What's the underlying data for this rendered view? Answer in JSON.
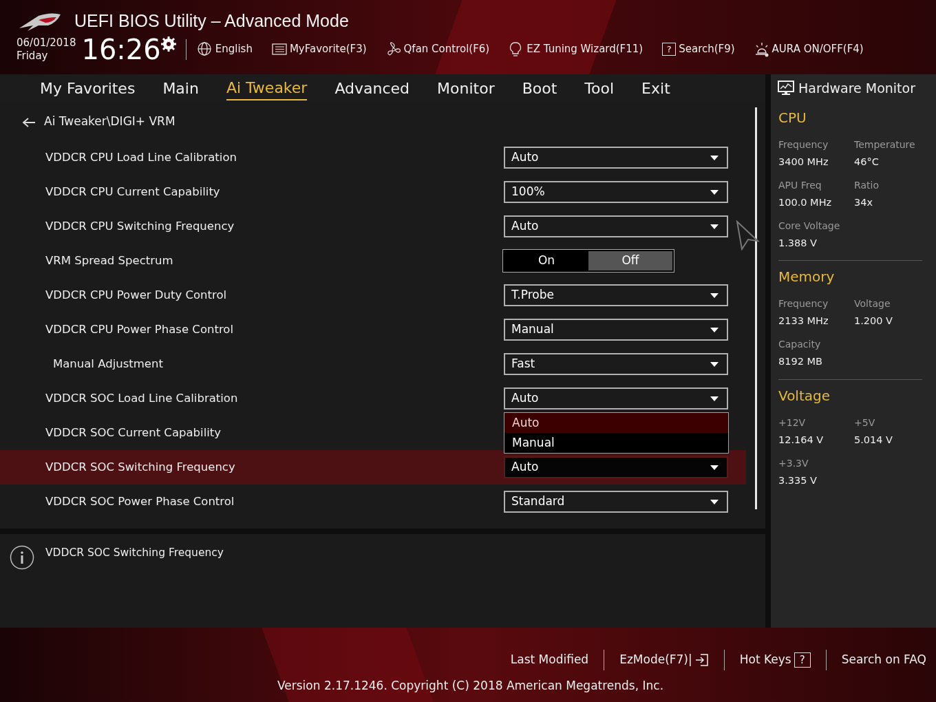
{
  "header": {
    "title": "UEFI BIOS Utility – Advanced Mode",
    "date": "06/01/2018",
    "day": "Friday",
    "time": "16:26",
    "tools": [
      {
        "label": "English"
      },
      {
        "label": "MyFavorite(F3)"
      },
      {
        "label": "Qfan Control(F6)"
      },
      {
        "label": "EZ Tuning Wizard(F11)"
      },
      {
        "label": "Search(F9)",
        "glyph": "?"
      },
      {
        "label": "AURA ON/OFF(F4)"
      }
    ]
  },
  "tabs": [
    {
      "label": "My Favorites",
      "selected": false
    },
    {
      "label": "Main",
      "selected": false
    },
    {
      "label": "Ai Tweaker",
      "selected": true
    },
    {
      "label": "Advanced",
      "selected": false
    },
    {
      "label": "Monitor",
      "selected": false
    },
    {
      "label": "Boot",
      "selected": false
    },
    {
      "label": "Tool",
      "selected": false
    },
    {
      "label": "Exit",
      "selected": false
    }
  ],
  "breadcrumb": "Ai Tweaker\\DIGI+ VRM",
  "settings": [
    {
      "label": "VDDCR CPU Load Line Calibration",
      "kind": "select",
      "value": "Auto",
      "selected": false
    },
    {
      "label": "VDDCR CPU Current Capability",
      "kind": "select",
      "value": "100%",
      "selected": false
    },
    {
      "label": "VDDCR CPU Switching Frequency",
      "kind": "select",
      "value": "Auto",
      "selected": false
    },
    {
      "label": "VRM Spread Spectrum",
      "kind": "toggle",
      "options": [
        {
          "label": "On",
          "selected": false
        },
        {
          "label": "Off",
          "selected": true
        }
      ],
      "selected": false
    },
    {
      "label": "VDDCR CPU Power Duty Control",
      "kind": "select",
      "value": "T.Probe",
      "selected": false
    },
    {
      "label": "VDDCR CPU Power Phase Control",
      "kind": "select",
      "value": "Manual",
      "selected": false,
      "children": [
        {
          "label": "Manual Adjustment",
          "kind": "select",
          "value": "Fast",
          "selected": false
        }
      ]
    },
    {
      "label": "VDDCR SOC Load Line Calibration",
      "kind": "select",
      "value": "Auto",
      "selected": false
    },
    {
      "label": "VDDCR SOC Current Capability",
      "kind": "menu",
      "options": [
        {
          "label": "Auto",
          "selected": true
        },
        {
          "label": "Manual",
          "selected": false
        }
      ],
      "selected": false
    },
    {
      "label": "VDDCR SOC Switching Frequency",
      "kind": "select",
      "value": "Auto",
      "selected": true
    },
    {
      "label": "VDDCR SOC Power Phase Control",
      "kind": "select",
      "value": "Standard",
      "selected": false
    }
  ],
  "help": "VDDCR SOC Switching Frequency",
  "monitor": {
    "title": "Hardware Monitor",
    "sections": [
      {
        "title": "CPU",
        "items": [
          {
            "label": "Frequency",
            "value": "3400 MHz"
          },
          {
            "label": "Temperature",
            "value": "46°C"
          },
          {
            "label": "APU Freq",
            "value": "100.0 MHz"
          },
          {
            "label": "Ratio",
            "value": "34x"
          },
          {
            "label": "Core Voltage",
            "value": "1.388 V"
          }
        ]
      },
      {
        "title": "Memory",
        "items": [
          {
            "label": "Frequency",
            "value": "2133 MHz"
          },
          {
            "label": "Voltage",
            "value": "1.200 V"
          },
          {
            "label": "Capacity",
            "value": "8192 MB"
          }
        ]
      },
      {
        "title": "Voltage",
        "items": [
          {
            "label": "+12V",
            "value": "12.164 V"
          },
          {
            "label": "+5V",
            "value": "5.014 V"
          },
          {
            "label": "+3.3V",
            "value": "3.335 V"
          }
        ]
      }
    ]
  },
  "footer": {
    "links": [
      {
        "label": "Last Modified"
      },
      {
        "label": "EzMode(F7)|"
      },
      {
        "label": "Hot Keys",
        "glyph": "?"
      },
      {
        "label": "Search on FAQ"
      }
    ],
    "version": "Version 2.17.1246. Copyright (C) 2018 American Megatrends, Inc."
  }
}
